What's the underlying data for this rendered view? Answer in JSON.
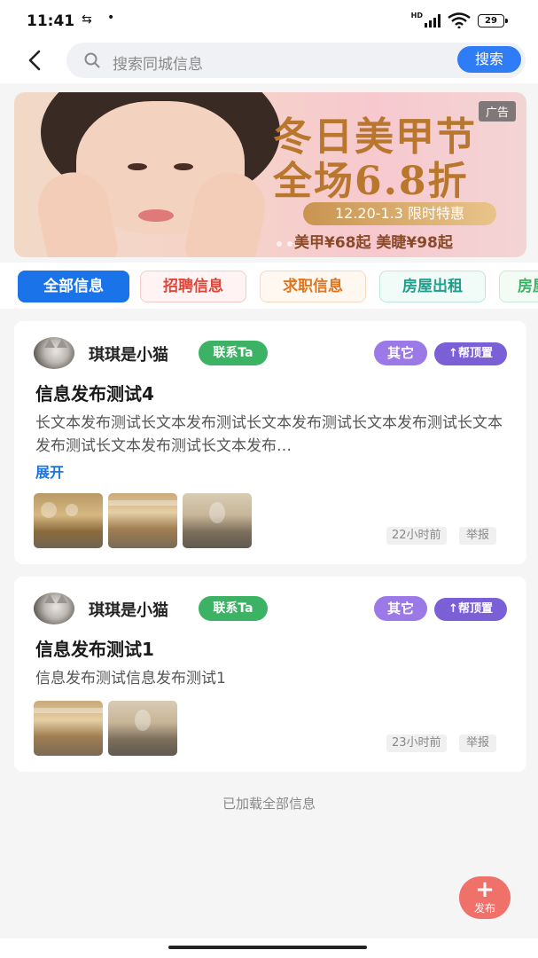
{
  "status_bar": {
    "time": "11:41",
    "usb_icon": "usb-icon",
    "dot": "•",
    "network": "HD",
    "battery": "29"
  },
  "header": {
    "back_icon": "chevron-left-icon",
    "search_placeholder": "搜索同城信息",
    "search_button": "搜索"
  },
  "banner": {
    "ad_tag": "广告",
    "title_line1": "冬日美甲节",
    "title_line2": "全场6.8折",
    "date": "12.20-1.3 限时特惠",
    "price": "美甲¥68起 美睫¥98起"
  },
  "tabs": [
    {
      "label": "全部信息",
      "active": true,
      "color": "#1a73e8"
    },
    {
      "label": "招聘信息",
      "active": false,
      "color": "#e0453a"
    },
    {
      "label": "求职信息",
      "active": false,
      "color": "#e0751f"
    },
    {
      "label": "房屋出租",
      "active": false,
      "color": "#1f9e8a"
    },
    {
      "label": "房屋",
      "active": false,
      "color": "#3cb265"
    }
  ],
  "posts": [
    {
      "username": "琪琪是小猫",
      "contact_label": "联系Ta",
      "category": "其它",
      "pin_label": "↑帮顶置",
      "title": "信息发布测试4",
      "description": "长文本发布测试长文本发布测试长文本发布测试长文本发布测试长文本发布测试长文本发布测试长文本发布…",
      "expand_label": "展开",
      "image_count": 3,
      "time": "22小时前",
      "report_label": "举报"
    },
    {
      "username": "琪琪是小猫",
      "contact_label": "联系Ta",
      "category": "其它",
      "pin_label": "↑帮顶置",
      "title": "信息发布测试1",
      "description": "信息发布测试信息发布测试1",
      "image_count": 2,
      "time": "23小时前",
      "report_label": "举报"
    }
  ],
  "footer": {
    "loaded_text": "已加载全部信息"
  },
  "fab": {
    "icon": "plus-icon",
    "label": "发布"
  },
  "colors": {
    "primary": "#1a73e8",
    "contact_green": "#3cb265",
    "category_purple": "#9b7ae8",
    "pin_purple": "#7a5fd6",
    "fab_red": "#f0706a"
  }
}
